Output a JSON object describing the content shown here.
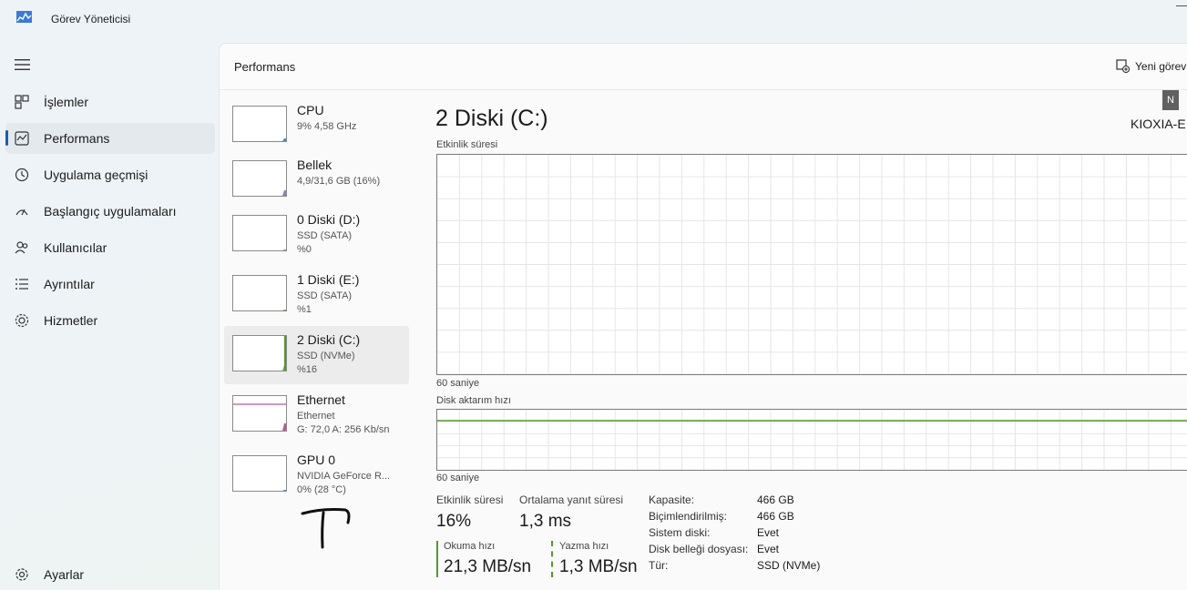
{
  "window": {
    "title": "Görev Yöneticisi"
  },
  "nav": {
    "items": [
      {
        "label": "İşlemler",
        "icon": "processes-icon"
      },
      {
        "label": "Performans",
        "icon": "performance-icon",
        "active": true
      },
      {
        "label": "Uygulama geçmişi",
        "icon": "history-icon"
      },
      {
        "label": "Başlangıç uygulamaları",
        "icon": "startup-icon"
      },
      {
        "label": "Kullanıcılar",
        "icon": "users-icon"
      },
      {
        "label": "Ayrıntılar",
        "icon": "details-icon"
      },
      {
        "label": "Hizmetler",
        "icon": "services-icon"
      }
    ],
    "settings_label": "Ayarlar"
  },
  "header": {
    "title": "Performans",
    "new_task": "Yeni görev"
  },
  "devices": [
    {
      "name": "CPU",
      "line2": "9% 4,58 GHz",
      "line3": "",
      "color": "#1a73b8",
      "usage": 0.09
    },
    {
      "name": "Bellek",
      "line2": "4,9/31,6 GB (16%)",
      "line3": "",
      "color": "#7a5bb0",
      "usage": 0.16
    },
    {
      "name": "0 Diski (D:)",
      "line2": "SSD (SATA)",
      "line3": "%0",
      "color": "#4f9a2a",
      "usage": 0
    },
    {
      "name": "1 Diski (E:)",
      "line2": "SSD (SATA)",
      "line3": "%1",
      "color": "#4f9a2a",
      "usage": 0.01
    },
    {
      "name": "2 Diski (C:)",
      "line2": "SSD (NVMe)",
      "line3": "%16",
      "color": "#4f9a2a",
      "usage": 0.16,
      "selected": true
    },
    {
      "name": "Ethernet",
      "line2": "Ethernet",
      "line3": "G: 72,0 A: 256 Kb/sn",
      "color": "#a8327a",
      "usage": 0.2
    },
    {
      "name": "GPU 0",
      "line2": "NVIDIA GeForce R...",
      "line3": "0%  (28 °C)",
      "color": "#1a73b8",
      "usage": 0
    }
  ],
  "detail": {
    "title": "2 Diski (C:)",
    "model": "KIOXIA-E",
    "model_badge": "N",
    "graph1_label": "Etkinlik süresi",
    "graph1_time": "60 saniye",
    "graph2_label": "Disk aktarım hızı",
    "graph2_time": "60 saniye",
    "graph_color": "#4f9a2a",
    "stats": {
      "activity_label": "Etkinlik süresi",
      "activity_value": "16%",
      "response_label": "Ortalama yanıt süresi",
      "response_value": "1,3 ms",
      "read_label": "Okuma hızı",
      "read_value": "21,3 MB/sn",
      "write_label": "Yazma hızı",
      "write_value": "1,3 MB/sn"
    },
    "properties": [
      {
        "key": "Kapasite:",
        "value": "466 GB"
      },
      {
        "key": "Biçimlendirilmiş:",
        "value": "466 GB"
      },
      {
        "key": "Sistem diski:",
        "value": "Evet"
      },
      {
        "key": "Disk belleği dosyası:",
        "value": "Evet"
      },
      {
        "key": "Tür:",
        "value": "SSD (NVMe)"
      }
    ]
  }
}
